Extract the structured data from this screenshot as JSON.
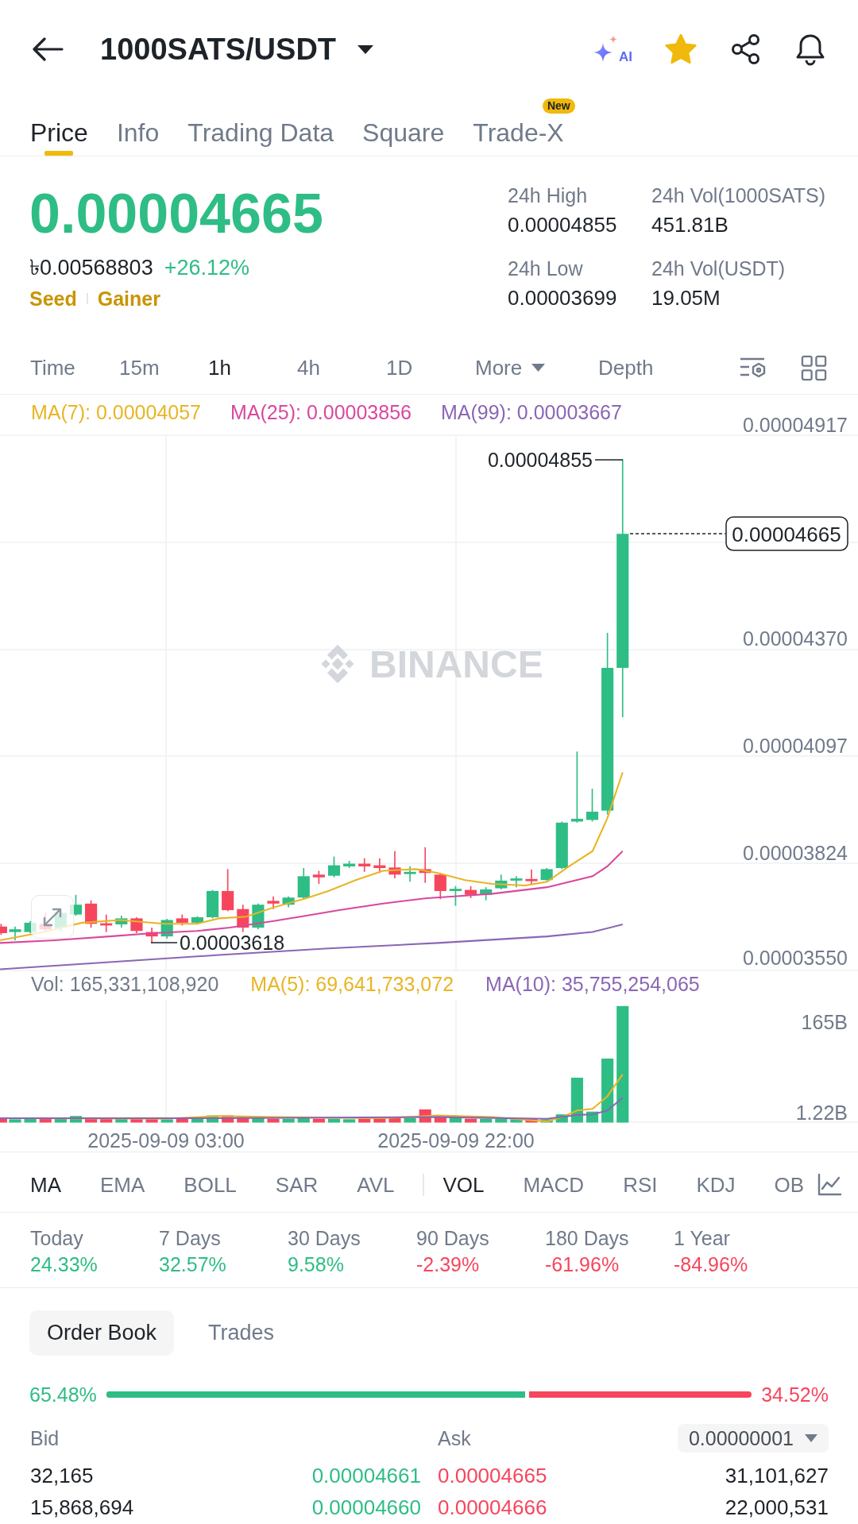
{
  "header": {
    "title": "1000SATS/USDT",
    "ai_label": "AI",
    "favorite": true
  },
  "tabs": [
    {
      "label": "Price",
      "selected": true
    },
    {
      "label": "Info",
      "selected": false
    },
    {
      "label": "Trading Data",
      "selected": false
    },
    {
      "label": "Square",
      "selected": false
    },
    {
      "label": "Trade-X",
      "selected": false,
      "badge": "New"
    }
  ],
  "price": {
    "last": "0.00004665",
    "local": "৳0.00568803",
    "change": "+26.12%",
    "rising": true,
    "tags": [
      "Seed",
      "Gainer"
    ]
  },
  "stats": [
    {
      "label": "24h High",
      "value": "0.00004855"
    },
    {
      "label": "24h Vol(1000SATS)",
      "value": "451.81B"
    },
    {
      "label": "24h Low",
      "value": "0.00003699"
    },
    {
      "label": "24h Vol(USDT)",
      "value": "19.05M"
    }
  ],
  "intervals": [
    {
      "label": "Time",
      "kind": "option",
      "selected": false
    },
    {
      "label": "15m",
      "kind": "option",
      "selected": false
    },
    {
      "label": "1h",
      "kind": "option",
      "selected": true
    },
    {
      "label": "4h",
      "kind": "option",
      "selected": false
    },
    {
      "label": "1D",
      "kind": "option",
      "selected": false
    },
    {
      "label": "More",
      "kind": "dropdown",
      "selected": false
    },
    {
      "label": "Depth",
      "kind": "option",
      "selected": false
    }
  ],
  "chart": {
    "ma_legend": [
      {
        "label": "MA(7): 0.00004057",
        "color": "#e8b524"
      },
      {
        "label": "MA(25): 0.00003856",
        "color": "#d9489f"
      },
      {
        "label": "MA(99): 0.00003667",
        "color": "#8a66b5"
      }
    ],
    "y_axis": [
      "0.00004917",
      "0.00004370",
      "0.00004097",
      "0.00003824",
      "0.00003550"
    ],
    "high_marker": "0.00004855",
    "low_marker": "0.00003618",
    "last_price": "0.00004665",
    "watermark": "BINANCE",
    "volume_legend": [
      {
        "label": "Vol: 165,331,108,920",
        "color": "#707a8a"
      },
      {
        "label": "MA(5): 69,641,733,072",
        "color": "#e8b524"
      },
      {
        "label": "MA(10): 35,755,254,065",
        "color": "#8a66b5"
      }
    ],
    "volume_axis": [
      "165B",
      "1.22B"
    ],
    "x_axis": [
      "2025-09-09 03:00",
      "2025-09-09 22:00"
    ]
  },
  "indicators": {
    "main": [
      {
        "label": "MA",
        "selected": true
      },
      {
        "label": "EMA",
        "selected": false
      },
      {
        "label": "BOLL",
        "selected": false
      },
      {
        "label": "SAR",
        "selected": false
      },
      {
        "label": "AVL",
        "selected": false
      }
    ],
    "sub": [
      {
        "label": "VOL",
        "selected": true
      },
      {
        "label": "MACD",
        "selected": false
      },
      {
        "label": "RSI",
        "selected": false
      },
      {
        "label": "KDJ",
        "selected": false
      },
      {
        "label": "OB",
        "selected": false
      }
    ]
  },
  "performance": [
    {
      "label": "Today",
      "value": "24.33%",
      "rising": true
    },
    {
      "label": "7 Days",
      "value": "32.57%",
      "rising": true
    },
    {
      "label": "30 Days",
      "value": "9.58%",
      "rising": true
    },
    {
      "label": "90 Days",
      "value": "-2.39%",
      "rising": false
    },
    {
      "label": "180 Days",
      "value": "-61.96%",
      "rising": false
    },
    {
      "label": "1 Year",
      "value": "-84.96%",
      "rising": false
    }
  ],
  "order_book": {
    "tabs": [
      {
        "label": "Order Book",
        "selected": true
      },
      {
        "label": "Trades",
        "selected": false
      }
    ],
    "bid_share": "65.48%",
    "ask_share": "34.52%",
    "level": 0.6548,
    "bid_label": "Bid",
    "ask_label": "Ask",
    "precision": "0.00000001",
    "rows": [
      {
        "bid_amount": "32,165",
        "bid_price": "0.00004661",
        "ask_price": "0.00004665",
        "ask_amount": "31,101,627"
      },
      {
        "bid_amount": "15,868,694",
        "bid_price": "0.00004660",
        "ask_price": "0.00004666",
        "ask_amount": "22,000,531"
      }
    ]
  }
}
